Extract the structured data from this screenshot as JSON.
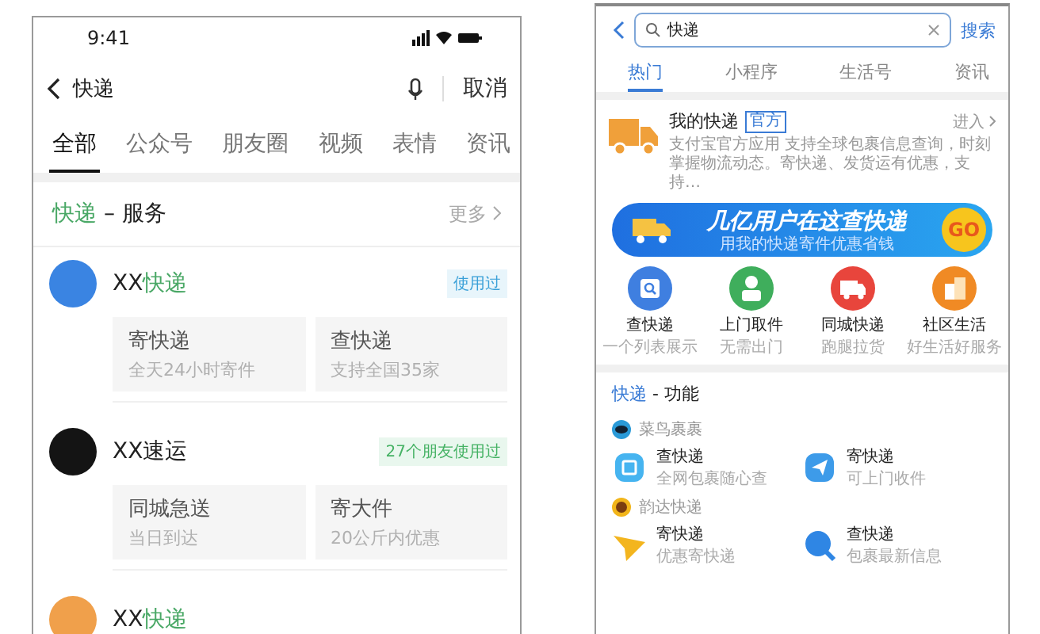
{
  "left_screen": {
    "status_bar": {
      "time": "9:41"
    },
    "search": {
      "value": "快递"
    },
    "cancel": "取消",
    "tabs": [
      {
        "label": "全部",
        "selected": true
      },
      {
        "label": "公众号",
        "selected": false
      },
      {
        "label": "朋友圈",
        "selected": false
      },
      {
        "label": "视频",
        "selected": false
      },
      {
        "label": "表情",
        "selected": false
      },
      {
        "label": "资讯",
        "selected": false
      }
    ],
    "section": {
      "keyword": "快递",
      "title": "– 服务",
      "more": "更多"
    },
    "providers": [
      {
        "name": "XX",
        "keyword": "快递",
        "color": "#3a84e2",
        "badge": {
          "kind": "used",
          "text": "使用过"
        },
        "services": [
          {
            "title": "寄快递",
            "subtitle": "全天24小时寄件"
          },
          {
            "title": "查快递",
            "subtitle": "支持全国35家"
          }
        ]
      },
      {
        "name": "XX速运",
        "color": "#141414",
        "badge": {
          "kind": "friends",
          "text": "27个朋友使用过"
        },
        "services": [
          {
            "title": "同城急送",
            "subtitle": "当日到达"
          },
          {
            "title": "寄大件",
            "subtitle": "20公斤内优惠"
          }
        ]
      },
      {
        "name": "XX",
        "keyword": "快递",
        "color": "#f0a04b"
      }
    ]
  },
  "right_screen": {
    "search": {
      "value": "快递"
    },
    "search_button": "搜索",
    "tabs": [
      {
        "label": "热门",
        "selected": true
      },
      {
        "label": "小程序",
        "selected": false
      },
      {
        "label": "生活号",
        "selected": false
      },
      {
        "label": "资讯",
        "selected": false
      }
    ],
    "app_card": {
      "title": "我的快递",
      "tag": "官方",
      "enter": "进入",
      "description": "支付宝官方应用 支持全球包裹信息查询，时刻掌握物流动态。寄快递、发货运有优惠，支持…"
    },
    "banner": {
      "title": "几亿用户在这查快递",
      "subtitle": "用我的快递寄件优惠省钱",
      "go": "GO"
    },
    "shortcuts": [
      {
        "kind": "search",
        "color": "#3f7fe0",
        "title": "查快递",
        "subtitle": "一个列表展示"
      },
      {
        "kind": "courier",
        "color": "#3fae5c",
        "title": "上门取件",
        "subtitle": "无需出门"
      },
      {
        "kind": "van",
        "color": "#e8453c",
        "title": "同城快递",
        "subtitle": "跑腿拉货"
      },
      {
        "kind": "building",
        "color": "#f08a24",
        "title": "社区生活",
        "subtitle": "好生活好服务"
      }
    ],
    "functions": {
      "keyword": "快递",
      "title": "- 功能",
      "groups": [
        {
          "name": "菜鸟裹裹",
          "kind": "bird",
          "items": [
            {
              "kind": "box",
              "title": "查快递",
              "subtitle": "全网包裹随心查"
            },
            {
              "kind": "send",
              "title": "寄快递",
              "subtitle": "可上门收件"
            }
          ]
        },
        {
          "name": "韵达快递",
          "kind": "face",
          "items": [
            {
              "kind": "plane",
              "title": "寄快递",
              "subtitle": "优惠寄快递"
            },
            {
              "kind": "magnifier",
              "title": "查快递",
              "subtitle": "包裹最新信息"
            }
          ]
        }
      ]
    }
  }
}
